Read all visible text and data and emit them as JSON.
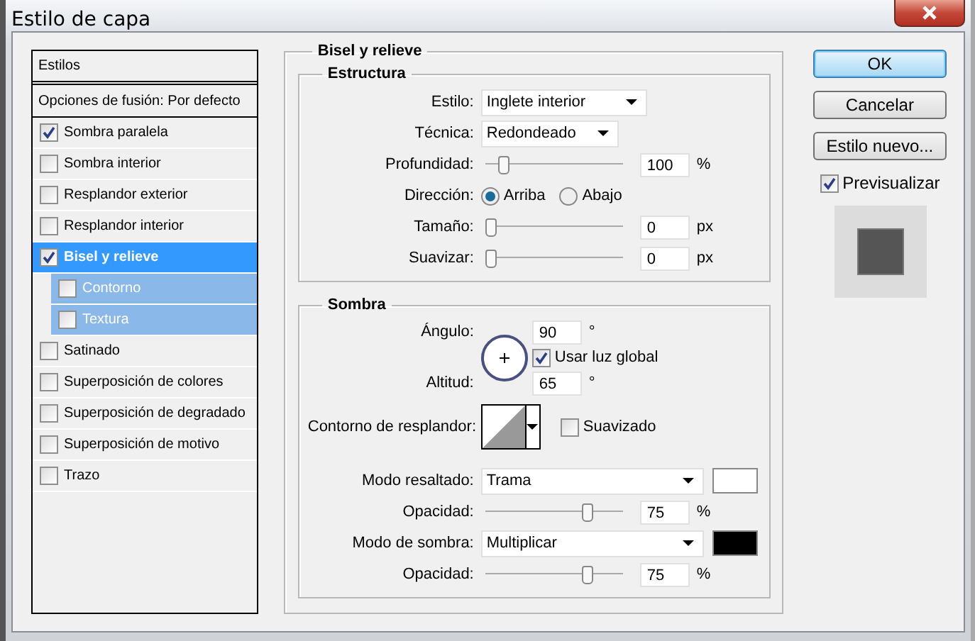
{
  "window": {
    "title": "Estilo de capa"
  },
  "styles_panel": {
    "header": "Estilos",
    "blending_options": "Opciones de fusión: Por defecto",
    "items": [
      {
        "label": "Sombra paralela",
        "checked": true,
        "selected": false
      },
      {
        "label": "Sombra interior",
        "checked": false,
        "selected": false
      },
      {
        "label": "Resplandor exterior",
        "checked": false,
        "selected": false
      },
      {
        "label": "Resplandor interior",
        "checked": false,
        "selected": false
      },
      {
        "label": "Bisel y relieve",
        "checked": true,
        "selected": true,
        "children": [
          {
            "label": "Contorno",
            "checked": false,
            "selected": false
          },
          {
            "label": "Textura",
            "checked": false,
            "selected": false
          }
        ]
      },
      {
        "label": "Satinado",
        "checked": false,
        "selected": false
      },
      {
        "label": "Superposición de colores",
        "checked": false,
        "selected": false
      },
      {
        "label": "Superposición de degradado",
        "checked": false,
        "selected": false
      },
      {
        "label": "Superposición de motivo",
        "checked": false,
        "selected": false
      },
      {
        "label": "Trazo",
        "checked": false,
        "selected": false
      }
    ]
  },
  "bevel": {
    "title": "Bisel y relieve",
    "structure": {
      "title": "Estructura",
      "rows": [
        {
          "kind": "dropdown",
          "label": "Estilo:",
          "value": "Inglete interior"
        },
        {
          "kind": "dropdown",
          "label": "Técnica:",
          "value": "Redondeado"
        },
        {
          "kind": "slider",
          "label": "Profundidad:",
          "level": 0.1,
          "value": "100",
          "unit": "%"
        },
        {
          "kind": "radio",
          "label": "Dirección:",
          "options": [
            {
              "label": "Arriba",
              "selected": true
            },
            {
              "label": "Abajo",
              "selected": false
            }
          ]
        },
        {
          "kind": "slider",
          "label": "Tamaño:",
          "level": 0,
          "value": "0",
          "unit": "px"
        },
        {
          "kind": "slider",
          "label": "Suavizar:",
          "level": 0,
          "value": "0",
          "unit": "px"
        }
      ]
    },
    "shading": {
      "title": "Sombra",
      "angle": {
        "label": "Ángulo:",
        "value": "90",
        "unit": "°"
      },
      "global_light": {
        "label": "Usar luz global",
        "checked": true
      },
      "altitude": {
        "label": "Altitud:",
        "value": "65",
        "unit": "°"
      },
      "gloss_contour": {
        "label": "Contorno de resplandor:"
      },
      "anti_aliased": {
        "label": "Suavizado",
        "checked": false
      },
      "rows": [
        {
          "kind": "dropdown",
          "label": "Modo resaltado:",
          "value": "Trama",
          "color": "#ffffff"
        },
        {
          "kind": "slider",
          "label": "Opacidad:",
          "level": 0.75,
          "value": "75",
          "unit": "%"
        },
        {
          "kind": "dropdown",
          "label": "Modo de sombra:",
          "value": "Multiplicar",
          "color": "#000000"
        },
        {
          "kind": "slider",
          "label": "Opacidad:",
          "level": 0.75,
          "value": "75",
          "unit": "%"
        }
      ]
    }
  },
  "buttons": [
    {
      "label": "OK",
      "default": true
    },
    {
      "label": "Cancelar",
      "default": false
    },
    {
      "label": "Estilo nuevo...",
      "default": false
    }
  ],
  "preview": {
    "label": "Previsualizar",
    "checked": true
  }
}
